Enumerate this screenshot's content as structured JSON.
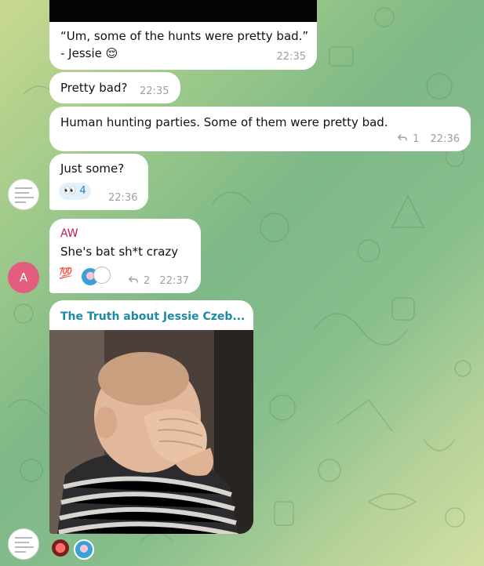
{
  "messages": [
    {
      "text_line1": "“Um, some of the hunts were pretty bad.”",
      "text_line2": "- Jessie",
      "emoji": "😌",
      "time": "22:35"
    },
    {
      "text": "Pretty bad?",
      "time": "22:35"
    },
    {
      "text": "Human hunting parties. Some of them were pretty bad.",
      "replies": "1",
      "time": "22:36"
    },
    {
      "text": "Just some?",
      "reaction_emoji": "👀",
      "reaction_count": "4",
      "time": "22:36"
    },
    {
      "sender": "AW",
      "text": "She's bat sh*t crazy",
      "reaction_emoji": "💯",
      "replies": "2",
      "time": "22:37"
    },
    {
      "link_title": "The Truth about Jessie Czeb..."
    }
  ],
  "avatars": {
    "aw_initial": "A"
  },
  "colors": {
    "sender_aw": "#c2185b",
    "link_title": "#1e88a8",
    "avatar_aw": "#e35d7f",
    "timestamp": "#9aa0a6"
  },
  "icons": {
    "reply": "reply-arrow-icon",
    "gif_thumbnail": "baby-facepalm-gif"
  }
}
